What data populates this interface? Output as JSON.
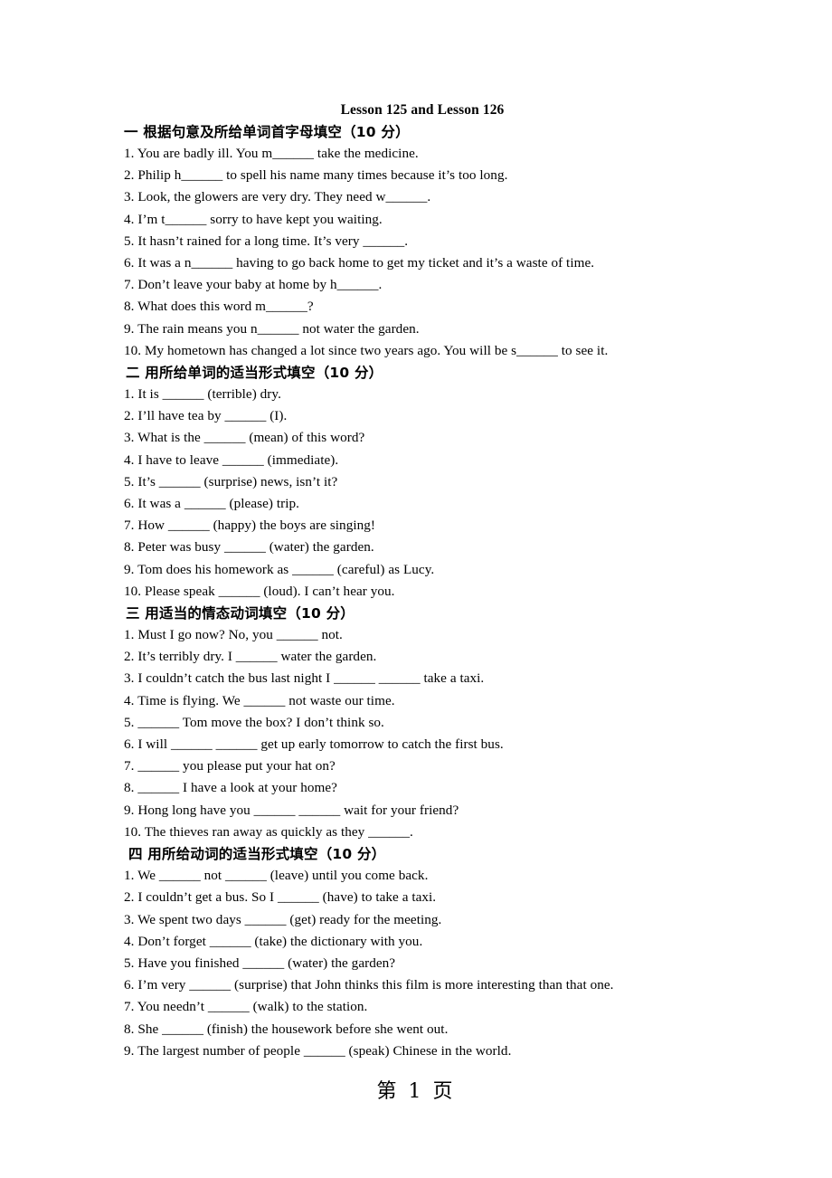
{
  "document": {
    "title": "Lesson 125 and Lesson 126",
    "footer": "第 1 页"
  },
  "sections": [
    {
      "heading": "一  根据句意及所给单词首字母填空（10 分）",
      "items": [
        "1. You are badly ill. You m______ take the medicine.",
        "2. Philip h______ to spell his name many times because it’s too long.",
        "3. Look, the glowers are very dry. They need w______.",
        "4. I’m t______ sorry to have kept you waiting.",
        "5. It hasn’t rained for a long time. It’s very ______.",
        "6. It was a n______ having to go back home to get my ticket and it’s a waste of time.",
        "7. Don’t leave your baby at home by h______.",
        "8. What does this word m______?",
        "9. The rain means you n______ not water the garden.",
        "10. My hometown has changed a lot since two years ago. You will be s______ to see it."
      ]
    },
    {
      "heading": "二  用所给单词的适当形式填空（10 分）",
      "items": [
        "1. It is ______ (terrible) dry.",
        "2. I’ll have tea by ______ (I).",
        "3. What is the ______ (mean) of this word?",
        "4. I have to leave ______ (immediate).",
        "5. It’s ______ (surprise) news, isn’t it?",
        "6. It was a ______ (please) trip.",
        "7. How ______ (happy) the boys are singing!",
        "8. Peter was busy ______ (water) the garden.",
        "9. Tom does his homework as ______ (careful) as Lucy.",
        "10. Please speak ______ (loud). I can’t hear you."
      ]
    },
    {
      "heading": "三  用适当的情态动词填空（10 分）",
      "items": [
        "1. Must I go now? No, you ______ not.",
        "2. It’s terribly dry. I ______ water the garden.",
        "3. I couldn’t catch the bus last night I ______ ______ take a taxi.",
        "4. Time is flying. We ______ not waste our time.",
        "5. ______ Tom move the box? I don’t think so.",
        "6. I will ______ ______ get up early tomorrow to catch the first bus.",
        "7. ______ you please put your hat on?",
        "8. ______ I have a look at your home?",
        "9. Hong long have you ______ ______ wait for your friend?",
        "10. The thieves ran away as quickly as they ______."
      ]
    },
    {
      "heading": "四  用所给动词的适当形式填空（10 分）",
      "items": [
        "1. We ______ not ______ (leave) until you come back.",
        "2. I couldn’t get a bus. So I ______ (have) to take a taxi.",
        "3. We spent two days ______ (get) ready for the meeting.",
        "4. Don’t forget ______ (take) the dictionary with you.",
        "5. Have you finished ______ (water) the garden?",
        "6. I’m very ______ (surprise) that John thinks this film is more interesting than that one.",
        "7. You needn’t ______ (walk) to the station.",
        "8. She ______ (finish) the housework before she went out.",
        "9. The largest number of people ______ (speak) Chinese in the world."
      ]
    }
  ]
}
